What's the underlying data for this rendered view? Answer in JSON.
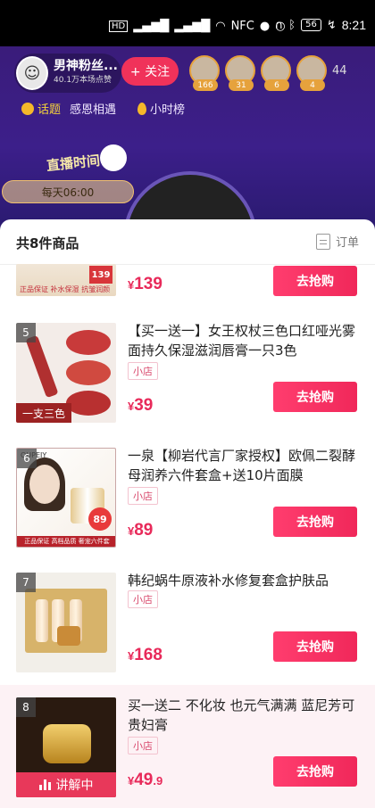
{
  "status_bar": {
    "left_icons": [
      "HD",
      "4G",
      "4G",
      "wifi",
      "NFC",
      "wechat",
      "bubble"
    ],
    "battery": "56",
    "time": "8:21"
  },
  "stream": {
    "host_name": "男神粉丝...",
    "host_sub": "40.1万本场点赞",
    "follow_label": "+ 关注",
    "viewer_badges": [
      "166",
      "31",
      "6",
      "4"
    ],
    "viewer_count": "44",
    "topic_label": "话题",
    "topic_text": "感恩相遇",
    "rank_label": "小时榜",
    "live_badge": "直播时间",
    "schedule": "每天06:00"
  },
  "sheet": {
    "title": "共8件商品",
    "order_label": "订单",
    "partial_item": {
      "price": "139",
      "badge": "139",
      "strip_text": "正品保证 补水保湿 抗皱润颜",
      "buy_label": "去抢购"
    },
    "products": [
      {
        "index": "5",
        "title": "【买一送一】女王权杖三色口红哑光雾面持久保湿滋润唇膏一只3色",
        "tag": "小店",
        "price": "39",
        "price_decimal": "",
        "buy_label": "去抢购",
        "thumb_caption": "一支三色"
      },
      {
        "index": "6",
        "title": "一泉【柳岩代言厂家授权】欧佩二裂酵母润养六件套盒+送10片面膜",
        "tag": "小店",
        "price": "89",
        "price_decimal": "",
        "buy_label": "去抢购",
        "thumb_brand": "OUPEIY",
        "thumb_badge": "89",
        "thumb_band": "正品保证 高档品质 奢宠六件套"
      },
      {
        "index": "7",
        "title": "韩纪蜗牛原液补水修复套盒护肤品",
        "tag": "小店",
        "price": "168",
        "price_decimal": "",
        "buy_label": "去抢购"
      },
      {
        "index": "8",
        "title": "买一送二 不化妆 也元气满满 蓝尼芳可贵妇膏",
        "tag": "小店",
        "price": "49",
        "price_decimal": ".9",
        "buy_label": "去抢购",
        "live_label": "讲解中"
      }
    ]
  },
  "currency_symbol": "¥",
  "colors": {
    "accent": "#f0285a",
    "price": "#e82a5a",
    "stream_bg": "#3a1c7a"
  }
}
